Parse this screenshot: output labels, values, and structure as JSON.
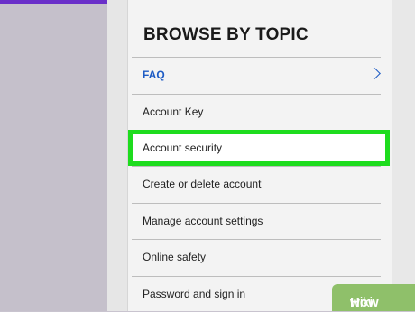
{
  "section": {
    "heading": "BROWSE BY TOPIC"
  },
  "topics": [
    {
      "label": "FAQ"
    },
    {
      "label": "Account Key"
    },
    {
      "label": "Account security"
    },
    {
      "label": "Create or delete account"
    },
    {
      "label": "Manage account settings"
    },
    {
      "label": "Online safety"
    },
    {
      "label": "Password and sign in"
    }
  ],
  "watermark": {
    "prefix": "wiki",
    "suffix": "How"
  },
  "colors": {
    "accent": "#6a2fc9",
    "link": "#1d5bc4",
    "highlight": "#1edc1e"
  }
}
